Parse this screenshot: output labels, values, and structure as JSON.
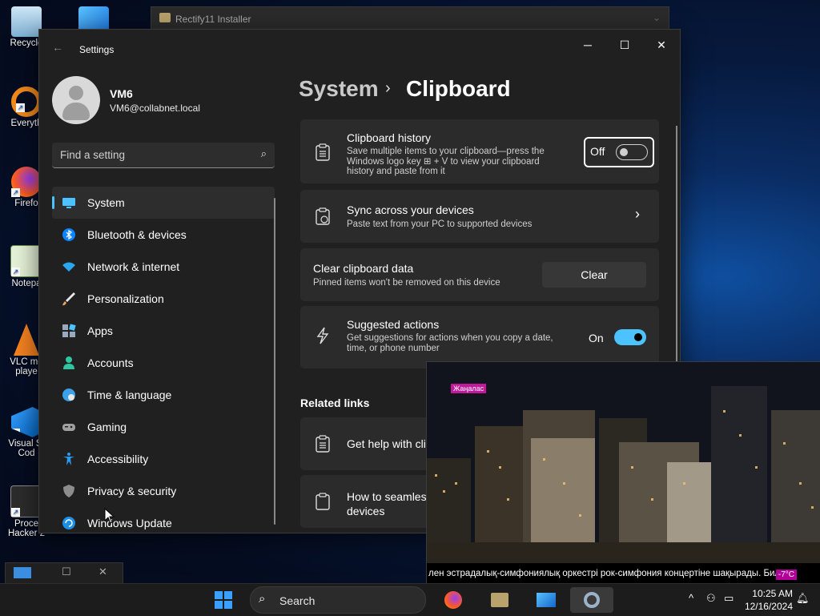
{
  "desktop": {
    "icons": [
      {
        "label": "Recycle"
      },
      {
        "label": "Everyth"
      },
      {
        "label": "Firefo"
      },
      {
        "label": "Notepa"
      },
      {
        "label": "VLC me\nplaye"
      },
      {
        "label": "Visual St\nCod"
      },
      {
        "label": "Proce\nHacker 2"
      }
    ]
  },
  "installer": {
    "title": "Rectify11 Installer"
  },
  "window": {
    "title": "Settings",
    "minimize": "─",
    "maximize": "☐",
    "close": "✕"
  },
  "user": {
    "name": "VM6",
    "email": "VM6@collabnet.local"
  },
  "search": {
    "placeholder": "Find a setting"
  },
  "nav": {
    "items": [
      {
        "label": "System",
        "icon": "monitor-icon",
        "color": "#4cc2ff"
      },
      {
        "label": "Bluetooth & devices",
        "icon": "bluetooth-icon",
        "color": "#0a84ff"
      },
      {
        "label": "Network & internet",
        "icon": "wifi-icon",
        "color": "#29a8f0"
      },
      {
        "label": "Personalization",
        "icon": "brush-icon",
        "color": "#e8a15a"
      },
      {
        "label": "Apps",
        "icon": "apps-icon",
        "color": "#9aa9bd"
      },
      {
        "label": "Accounts",
        "icon": "person-icon",
        "color": "#2ec5a0"
      },
      {
        "label": "Time & language",
        "icon": "globe-clock-icon",
        "color": "#3aa0e8"
      },
      {
        "label": "Gaming",
        "icon": "gamepad-icon",
        "color": "#a0a0a0"
      },
      {
        "label": "Accessibility",
        "icon": "accessibility-icon",
        "color": "#2a9cf0"
      },
      {
        "label": "Privacy & security",
        "icon": "shield-icon",
        "color": "#8c8c8c"
      },
      {
        "label": "Windows Update",
        "icon": "refresh-icon",
        "color": "#1e8fe6"
      }
    ]
  },
  "breadcrumb": {
    "parent": "System",
    "separator": "›",
    "current": "Clipboard"
  },
  "cards": {
    "history": {
      "title": "Clipboard history",
      "desc": "Save multiple items to your clipboard—press the Windows logo key ⊞ + V to view your clipboard history and paste from it",
      "state_label": "Off"
    },
    "sync": {
      "title": "Sync across your devices",
      "desc": "Paste text from your PC to supported devices",
      "chevron": "›"
    },
    "clear": {
      "title": "Clear clipboard data",
      "desc": "Pinned items won't be removed on this device",
      "button": "Clear"
    },
    "suggested": {
      "title": "Suggested actions",
      "desc": "Get suggestions for actions when you copy a date, time, or phone number",
      "state_label": "On"
    }
  },
  "related": {
    "title": "Related links",
    "links": [
      {
        "label": "Get help with cli"
      },
      {
        "label": "How to seamles\ndevices"
      }
    ]
  },
  "video": {
    "tag": "Жаңалас",
    "ticker": "лен эстрадалық-симфониялық оркестрі рок-симфония концертіне шақырады. Биле",
    "temp": "-7°C"
  },
  "taskbar": {
    "search_placeholder": "Search",
    "time": "10:25 AM",
    "date": "12/16/2024",
    "tray_chevron": "^"
  },
  "colors": {
    "accent": "#4cc2ff",
    "window_bg": "#202020",
    "card_bg": "#2b2b2b"
  }
}
